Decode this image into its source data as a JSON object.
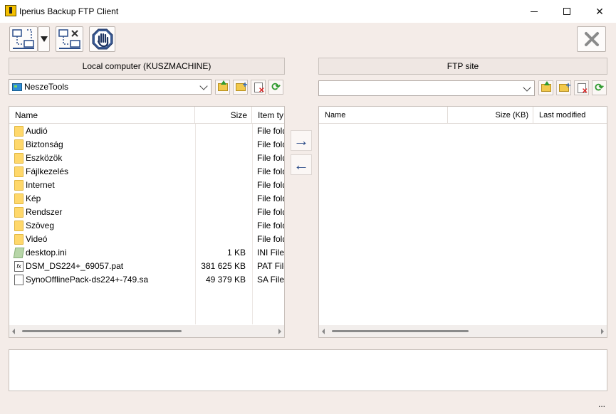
{
  "window": {
    "title": "Iperius Backup FTP Client"
  },
  "toolbar": {
    "connect_icon": "connect-icon",
    "dropdown_icon": "chevron-down-icon",
    "disconnect_icon": "disconnect-icon",
    "stop_icon": "stop-hand-icon",
    "close_icon": "close-icon"
  },
  "local": {
    "header": "Local computer  (KUSZMACHINE)",
    "path": "NeszeTools",
    "columns": [
      "Name",
      "Size",
      "Item ty"
    ],
    "rows": [
      {
        "name": "Audió",
        "size": "",
        "type": "File folder",
        "icon": "folder"
      },
      {
        "name": "Biztonság",
        "size": "",
        "type": "File folder",
        "icon": "folder"
      },
      {
        "name": "Eszközök",
        "size": "",
        "type": "File folder",
        "icon": "folder"
      },
      {
        "name": "Fájlkezelés",
        "size": "",
        "type": "File folder",
        "icon": "folder"
      },
      {
        "name": "Internet",
        "size": "",
        "type": "File folder",
        "icon": "folder"
      },
      {
        "name": "Kép",
        "size": "",
        "type": "File folder",
        "icon": "folder"
      },
      {
        "name": "Rendszer",
        "size": "",
        "type": "File folder",
        "icon": "folder"
      },
      {
        "name": "Szöveg",
        "size": "",
        "type": "File folder",
        "icon": "folder"
      },
      {
        "name": "Videó",
        "size": "",
        "type": "File folder",
        "icon": "folder"
      },
      {
        "name": "desktop.ini",
        "size": "1 KB",
        "type": "INI File",
        "icon": "ini"
      },
      {
        "name": "DSM_DS224+_69057.pat",
        "size": "381 625 KB",
        "type": "PAT File",
        "icon": "pat"
      },
      {
        "name": "SynoOfflinePack-ds224+-749.sa",
        "size": "49 379 KB",
        "type": "SA File",
        "icon": "file"
      }
    ]
  },
  "ftp": {
    "header": "FTP site",
    "path": "",
    "columns": [
      "Name",
      "Size (KB)",
      "Last modified"
    ]
  },
  "transfer": {
    "upload_glyph": "→",
    "download_glyph": "←"
  },
  "statusbar": {
    "grip": "..."
  }
}
